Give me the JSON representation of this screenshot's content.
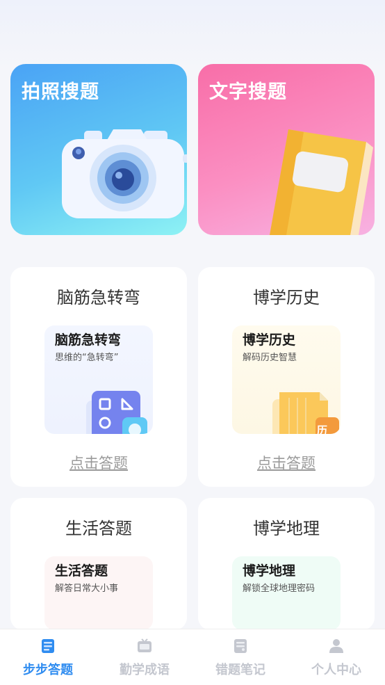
{
  "hero": {
    "photo_search": "拍照搜题",
    "text_search": "文字搜题"
  },
  "cards": [
    {
      "title": "脑筋急转弯",
      "inner_title": "脑筋急转弯",
      "inner_sub": "思维的“急转弯”",
      "action": "点击答题"
    },
    {
      "title": "博学历史",
      "inner_title": "博学历史",
      "inner_sub": "解码历史智慧",
      "action": "点击答题",
      "badge": "历"
    },
    {
      "title": "生活答题",
      "inner_title": "生活答题",
      "inner_sub": "解答日常大小事"
    },
    {
      "title": "博学地理",
      "inner_title": "博学地理",
      "inner_sub": "解锁全球地理密码"
    }
  ],
  "tabs": [
    {
      "label": "步步答题",
      "icon": "book-icon",
      "active": true
    },
    {
      "label": "勤学成语",
      "icon": "tv-icon",
      "active": false
    },
    {
      "label": "错题笔记",
      "icon": "notebook-icon",
      "active": false
    },
    {
      "label": "个人中心",
      "icon": "person-icon",
      "active": false
    }
  ],
  "colors": {
    "active_tab": "#2f8cf0",
    "inactive_tab": "#c4c7cf",
    "hero_blue": "#4aa3f5",
    "hero_pink": "#f86ea8"
  }
}
